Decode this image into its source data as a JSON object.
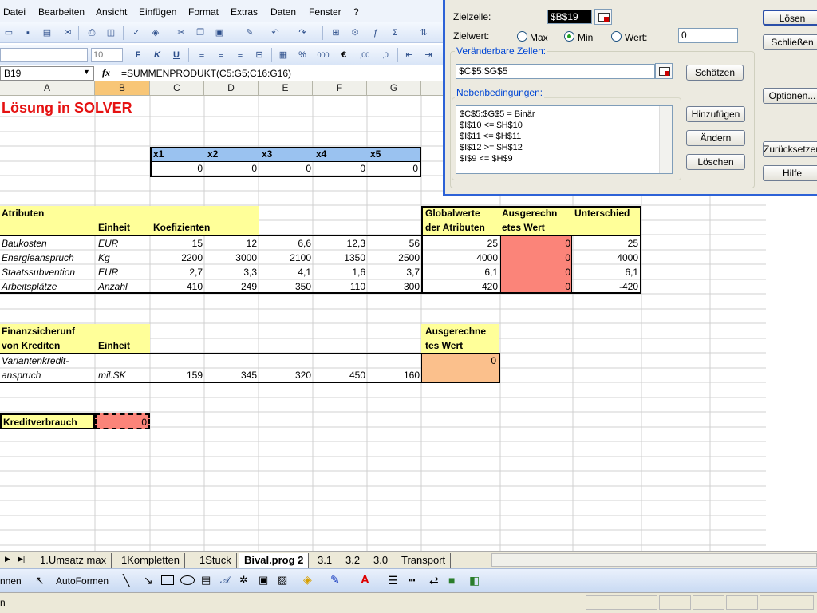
{
  "menu": [
    "Datei",
    "Bearbeiten",
    "Ansicht",
    "Einfügen",
    "Format",
    "Extras",
    "Daten",
    "Fenster",
    "?"
  ],
  "format_toolbar": {
    "font_size": "10"
  },
  "formula_bar": {
    "name_box": "B19",
    "fx": "fx",
    "formula": "=SUMMENPRODUKT(C5:G5;C16:G16)"
  },
  "columns": [
    "A",
    "B",
    "C",
    "D",
    "E",
    "F",
    "G"
  ],
  "sheet": {
    "title": "Lösung in SOLVER",
    "vars_header": [
      "x1",
      "x2",
      "x3",
      "x4",
      "x5"
    ],
    "vars_values": [
      "0",
      "0",
      "0",
      "0",
      "0"
    ],
    "attr": {
      "h_atributen": "Atributen",
      "h_einheit": "Einheit",
      "h_koef": "Koefizienten",
      "h_global1": "Globalwerte",
      "h_global2": "der Atributen",
      "h_ausg1": "Ausgerechn",
      "h_ausg2": "etes Wert",
      "h_unter": "Unterschied",
      "rows": [
        {
          "name": "Baukosten",
          "unit": "EUR",
          "coef": [
            "15",
            "12",
            "6,6",
            "12,3",
            "56"
          ],
          "global": "25",
          "ausg": "0",
          "unter": "25"
        },
        {
          "name": "Energieanspruch",
          "unit": "Kg",
          "coef": [
            "2200",
            "3000",
            "2100",
            "1350",
            "2500"
          ],
          "global": "4000",
          "ausg": "0",
          "unter": "4000"
        },
        {
          "name": "Staatssubvention",
          "unit": "EUR",
          "coef": [
            "2,7",
            "3,3",
            "4,1",
            "1,6",
            "3,7"
          ],
          "global": "6,1",
          "ausg": "0",
          "unter": "6,1"
        },
        {
          "name": "Arbeitsplätze",
          "unit": "Anzahl",
          "coef": [
            "410",
            "249",
            "350",
            "110",
            "300"
          ],
          "global": "420",
          "ausg": "0",
          "unter": "-420"
        }
      ]
    },
    "fin": {
      "h1": "Finanzsicherunf",
      "h2": "von Krediten",
      "h_einheit": "Einheit",
      "h_ausg1": "Ausgerechne",
      "h_ausg2": "tes Wert",
      "row_name1": "Variantenkredit-",
      "row_name2": "anspruch",
      "unit": "mil.SK",
      "values": [
        "159",
        "345",
        "320",
        "450",
        "160"
      ],
      "ausg": "0"
    },
    "kredit_label": "Kreditverbrauch",
    "kredit_value": "0"
  },
  "sheet_tabs": [
    "1.Umsatz max",
    "1Kompletten",
    "1Stuck",
    "Bival.prog 2",
    "3.1",
    "3.2",
    "3.0",
    "Transport"
  ],
  "active_tab": "Bival.prog 2",
  "draw_toolbar": {
    "zeichnen": "nnen",
    "autoformen": "AutoFormen"
  },
  "status": {
    "text": "n"
  },
  "solver": {
    "zielzelle_label": "Zielzelle:",
    "zielzelle_value": "$B$19",
    "zielwert_label": "Zielwert:",
    "opt_max": "Max",
    "opt_min": "Min",
    "opt_wert": "Wert:",
    "wert_value": "0",
    "veraenderbar_label": "Veränderbare Zellen:",
    "veraenderbar_value": "$C$5:$G$5",
    "neben_label": "Nebenbedingungen:",
    "constraints": [
      "$C$5:$G$5 = Binär",
      "$I$10 <= $H$10",
      "$I$11 <= $H$11",
      "$I$12 >= $H$12",
      "$I$9 <= $H$9"
    ],
    "btn_loesen": "Lösen",
    "btn_schliessen": "Schließen",
    "btn_schaetzen": "Schätzen",
    "btn_optionen": "Optionen...",
    "btn_hinzufuegen": "Hinzufügen",
    "btn_aendern": "Ändern",
    "btn_loeschen": "Löschen",
    "btn_zurueck": "Zurücksetzen",
    "btn_hilfe": "Hilfe"
  }
}
